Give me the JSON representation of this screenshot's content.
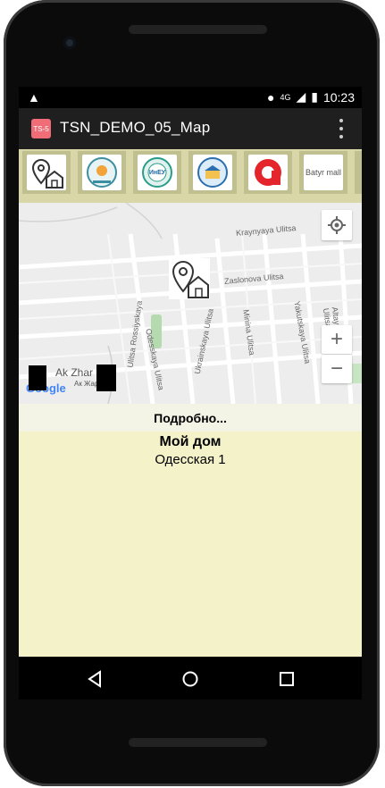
{
  "status_bar": {
    "network": "4G",
    "time": "10:23"
  },
  "app_bar": {
    "icon_text": "TS-5",
    "title": "TSN_DEMO_05_Map"
  },
  "carousel": {
    "items": [
      {
        "name": "home-location-logo"
      },
      {
        "name": "university-logo-1"
      },
      {
        "name": "university-logo-2",
        "text": "ИнЕУ"
      },
      {
        "name": "university-logo-3"
      },
      {
        "name": "red-logo"
      },
      {
        "name": "batyr-mall-logo",
        "text": "Batyr mall"
      }
    ]
  },
  "map": {
    "streets": [
      "Kraynyaya Ulitsa",
      "Zaslonova Ulitsa",
      "Odesskaya Ulitsa",
      "Ukrainskaya Ulitsa",
      "Ulitsa Rossiyskaya",
      "Minina Ulitsa",
      "Yakutskaya Ulitsa",
      "Altayskaya Ulitsa"
    ],
    "place_labels": [
      "Ak Zhar",
      "Ак Жар",
      "Google"
    ],
    "zoom_in": "+",
    "zoom_out": "−"
  },
  "details": {
    "header": "Подробно...",
    "name": "Мой дом",
    "address": "Одесская 1"
  },
  "colors": {
    "panel": "#f4f2c9",
    "strip": "#d9d7a7",
    "appbar": "#1f1f1f"
  }
}
